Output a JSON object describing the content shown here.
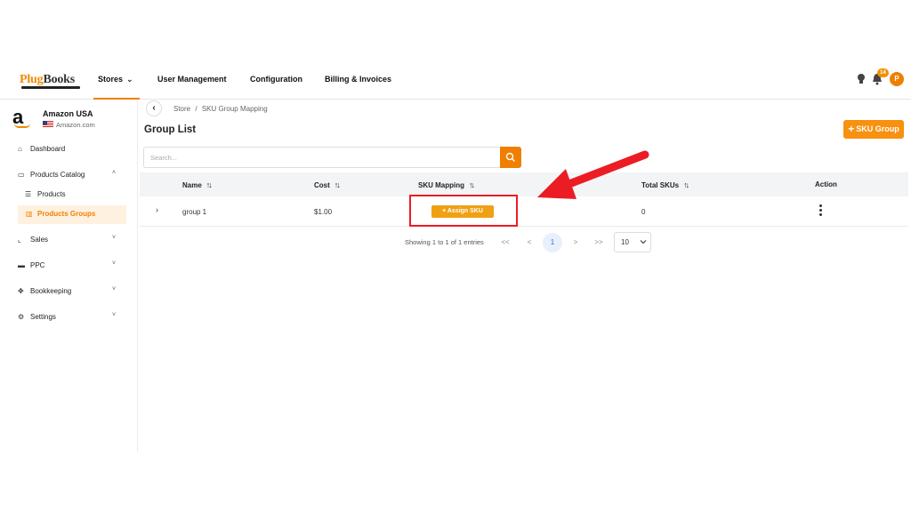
{
  "logo": {
    "part1": "Plug",
    "part2": "Books"
  },
  "nav": {
    "stores": "Stores",
    "user_management": "User Management",
    "configuration": "Configuration",
    "billing": "Billing & Invoices",
    "notifications_count": "14",
    "avatar_initial": "P"
  },
  "store": {
    "name": "Amazon USA",
    "marketplace": "Amazon.com"
  },
  "sidebar": {
    "dashboard": "Dashboard",
    "products_catalog": "Products Catalog",
    "products": "Products",
    "products_groups": "Products Groups",
    "sales": "Sales",
    "ppc": "PPC",
    "bookkeeping": "Bookkeeping",
    "settings": "Settings"
  },
  "breadcrumb": {
    "store": "Store",
    "separator": "/",
    "current": "SKU Group Mapping"
  },
  "page": {
    "title": "Group List",
    "add_button": "SKU Group",
    "search_placeholder": "Search..."
  },
  "table": {
    "columns": {
      "name": "Name",
      "cost": "Cost",
      "mapping": "SKU Mapping",
      "total": "Total SKUs",
      "action": "Action"
    },
    "rows": [
      {
        "name": "group 1",
        "cost": "$1.00",
        "mapping_button": "Assign SKU",
        "total": "0"
      }
    ]
  },
  "pagination": {
    "info": "Showing 1 to 1 of 1 entries",
    "first": "<<",
    "prev": "<",
    "current_page": "1",
    "next": ">",
    "last": ">>",
    "per_page": "10"
  },
  "colors": {
    "accent": "#f07f00",
    "annotation": "#ec1c24"
  }
}
